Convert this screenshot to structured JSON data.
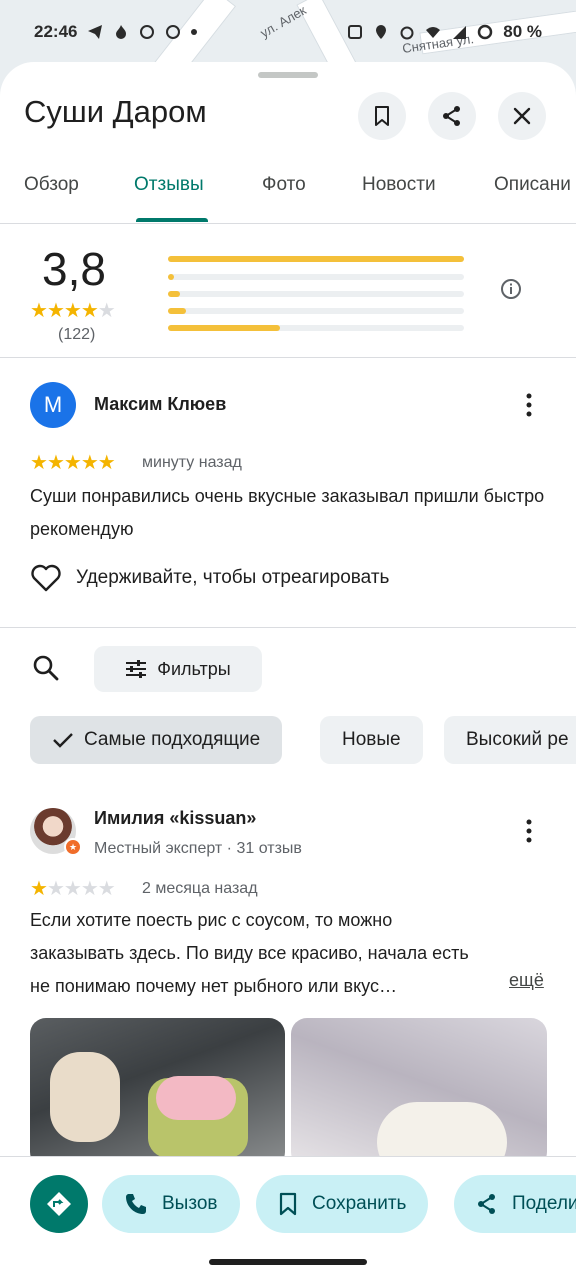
{
  "status_bar": {
    "time": "22:46",
    "battery": "80 %"
  },
  "map": {
    "street_1": "ул. Алек",
    "street_2": "Снятная ул."
  },
  "place": {
    "title": "Суши Даром"
  },
  "tabs": [
    {
      "label": "Обзор"
    },
    {
      "label": "Отзывы"
    },
    {
      "label": "Фото"
    },
    {
      "label": "Новости"
    },
    {
      "label": "Описани"
    }
  ],
  "rating": {
    "value": "3,8",
    "count": "(122)",
    "stars_filled": 4,
    "distribution": [
      1.0,
      0.02,
      0.04,
      0.06,
      0.38
    ]
  },
  "review1": {
    "avatar_letter": "М",
    "name": "Максим Клюев",
    "stars": 5,
    "time": "минуту назад",
    "text": "Суши понравились очень вкусные заказывал пришли быстро рекомендую",
    "react_label": "Удерживайте, чтобы отреагировать"
  },
  "filters": {
    "label": "Фильтры"
  },
  "sort_chips": [
    {
      "label": "Самые подходящие"
    },
    {
      "label": "Новые"
    },
    {
      "label": "Высокий ре"
    }
  ],
  "review2": {
    "name": "Имилия «kissuan»",
    "meta": "Местный эксперт · 31 отзыв",
    "stars": 1,
    "time": "2 месяца назад",
    "text": "Если хотите поесть рис с соусом, то можно заказывать здесь. По виду все красиво, начала есть не понимаю почему нет рыбного или вкус…",
    "more_label": "ещё"
  },
  "actions": [
    {
      "label": "Вызов"
    },
    {
      "label": "Сохранить"
    },
    {
      "label": "Подели"
    }
  ],
  "colors": {
    "accent": "#00796b",
    "star": "#f4b400",
    "action_bg": "#c9f0f5"
  }
}
